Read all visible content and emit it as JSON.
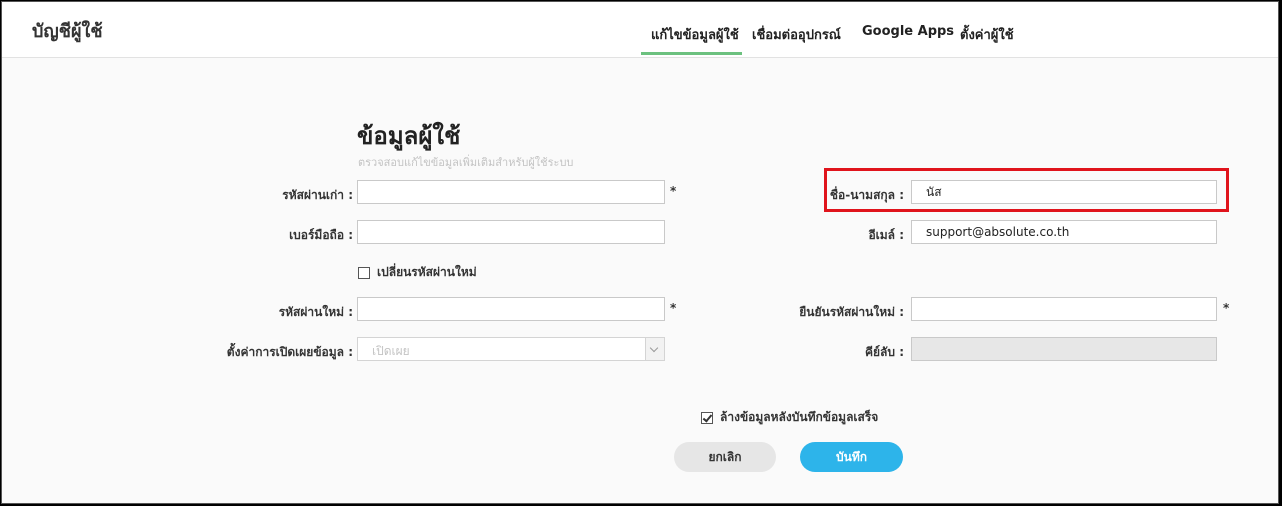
{
  "header": {
    "title": "บัญชีผู้ใช้",
    "tabs": [
      {
        "label": "แก้ไขข้อมูลผู้ใช้",
        "active": true
      },
      {
        "label": "เชื่อมต่ออุปกรณ์",
        "active": false
      },
      {
        "label": "Google Apps",
        "active": false
      },
      {
        "label": "ตั้งค่าผู้ใช้",
        "active": false
      }
    ]
  },
  "section": {
    "title": "ข้อมูลผู้ใช้",
    "subtitle": "ตรวจสอบแก้ไขข้อมูลเพิ่มเติมสำหรับผู้ใช้ระบบ"
  },
  "form": {
    "old_password": {
      "label": "รหัสผ่านเก่า :",
      "value": "",
      "required_mark": "*"
    },
    "full_name": {
      "label": "ชื่อ-นามสกุล :",
      "value": "นัส"
    },
    "mobile": {
      "label": "เบอร์มือถือ :",
      "value": ""
    },
    "email": {
      "label": "อีเมล์ :",
      "value": "support@absolute.co.th"
    },
    "change_password": {
      "label": "เปลี่ยนรหัสผ่านใหม่",
      "checked": false
    },
    "new_password": {
      "label": "รหัสผ่านใหม่ :",
      "value": "",
      "required_mark": "*"
    },
    "confirm_password": {
      "label": "ยืนยันรหัสผ่านใหม่ :",
      "value": "",
      "required_mark": "*"
    },
    "privacy": {
      "label": "ตั้งค่าการเปิดเผยข้อมูล :",
      "selected": "เปิดเผย"
    },
    "secret_key": {
      "label": "คีย์ลับ :",
      "value": ""
    },
    "clear_after_save": {
      "label": "ล้างข้อมูลหลังบันทึกข้อมูลเสร็จ",
      "checked": true
    }
  },
  "actions": {
    "cancel_label": "ยกเลิก",
    "save_label": "บันทึก"
  },
  "colors": {
    "accent_tab": "#6cc17f",
    "save_button": "#2db4ea",
    "highlight": "#e0141c"
  }
}
